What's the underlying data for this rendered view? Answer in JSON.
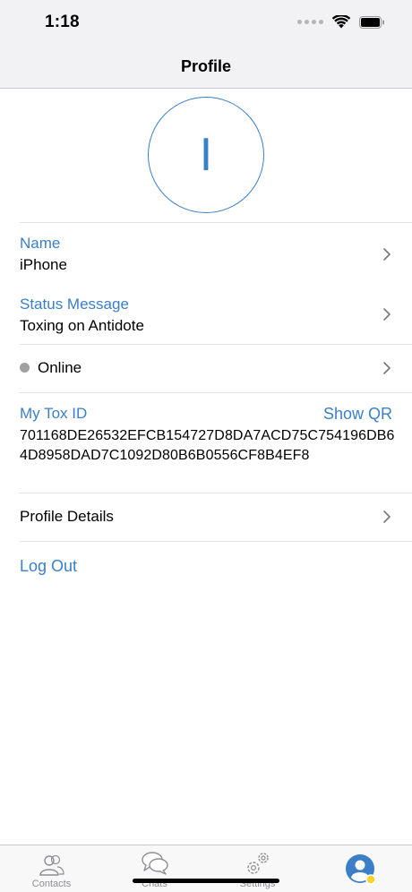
{
  "status_bar": {
    "time": "1:18"
  },
  "nav": {
    "title": "Profile"
  },
  "avatar": {
    "initial": "I"
  },
  "name_row": {
    "label": "Name",
    "value": "iPhone"
  },
  "status_row": {
    "label": "Status Message",
    "value": "Toxing on Antidote"
  },
  "online_row": {
    "label": "Online",
    "dot_color": "#a0a0a0"
  },
  "tox_id": {
    "label": "My Tox ID",
    "show_qr": "Show QR",
    "value": "701168DE26532EFCB154727D8DA7ACD75C754196DB64D8958DAD7C1092D80B6B0556CF8B4EF8"
  },
  "profile_details": {
    "label": "Profile Details"
  },
  "logout": {
    "label": "Log Out"
  },
  "tabs": [
    {
      "label": "Contacts",
      "icon": "contacts-icon"
    },
    {
      "label": "Chats",
      "icon": "chats-icon"
    },
    {
      "label": "Settings",
      "icon": "settings-icon"
    },
    {
      "label": "",
      "icon": "profile-avatar-icon",
      "badge_color": "#f5d52a"
    }
  ],
  "colors": {
    "accent": "#3a7fc8",
    "status_online": "#a0a0a0"
  }
}
